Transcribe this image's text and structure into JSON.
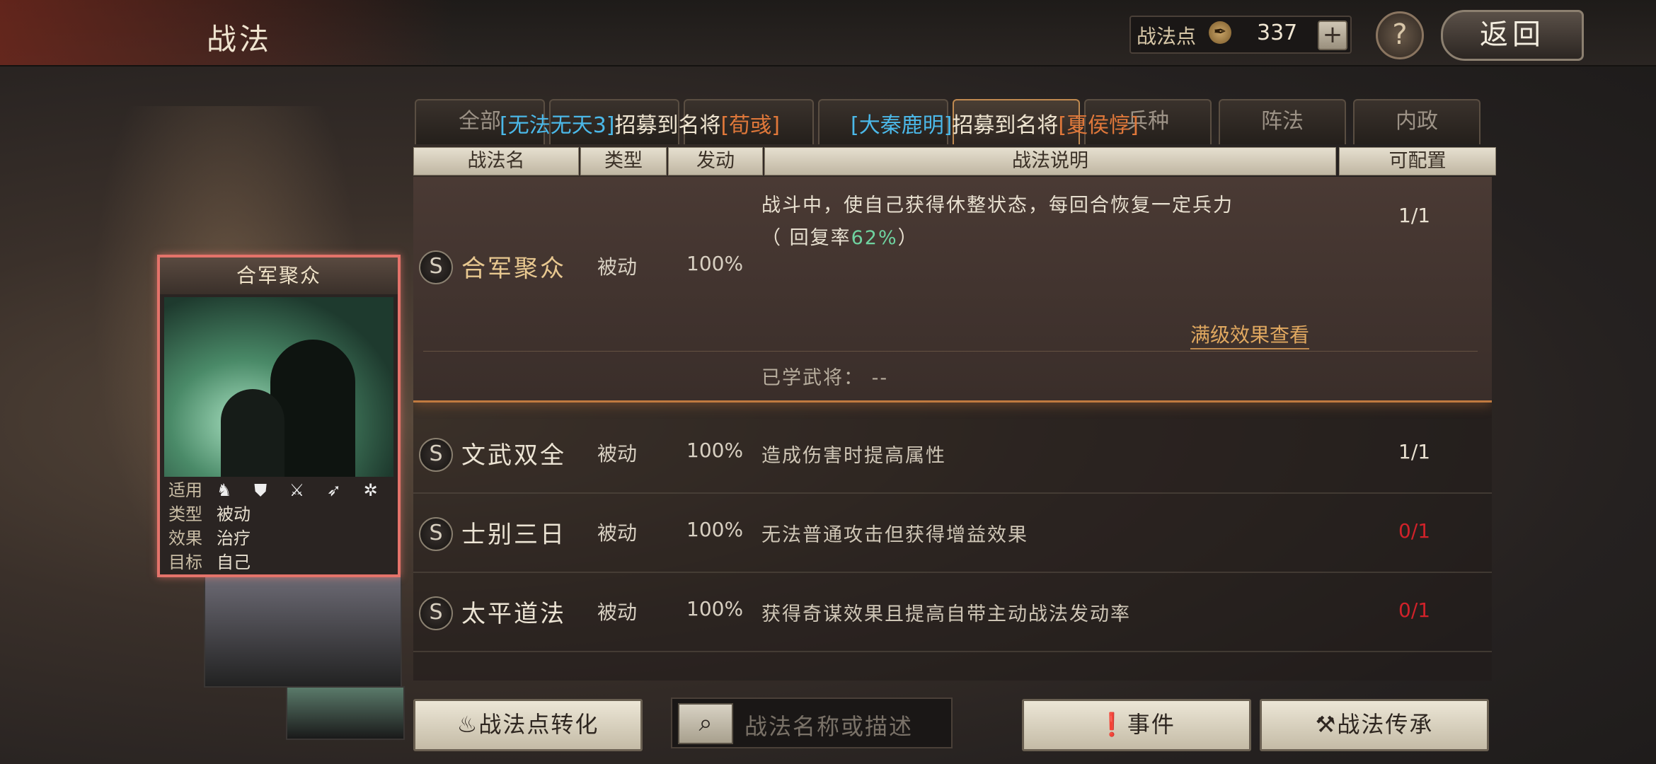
{
  "header": {
    "title": "战法",
    "points_label": "战法点",
    "points_icon": "feather-coin-icon",
    "points_value": "337",
    "plus": "+",
    "help": "?",
    "back": "返回"
  },
  "tabs": [
    {
      "label": "全部",
      "active": false
    },
    {
      "label": "",
      "active": false
    },
    {
      "label": "",
      "active": false
    },
    {
      "label": "",
      "active": false
    },
    {
      "label": "",
      "active": true
    },
    {
      "label": "兵种",
      "active": false
    },
    {
      "label": "阵法",
      "active": false
    },
    {
      "label": "内政",
      "active": false
    }
  ],
  "notices": [
    {
      "a": "[无法无天3]",
      "b": "招募到名将",
      "c": "[荀彧]"
    },
    {
      "a": "[大秦鹿明]",
      "b": "招募到名将",
      "c": "[夏侯惇]"
    }
  ],
  "columns": {
    "name": "战法名",
    "type": "类型",
    "trigger": "发动",
    "desc": "战法说明",
    "config": "可配置"
  },
  "selected": {
    "badge": "S",
    "name": "合军聚众",
    "type": "被动",
    "rate": "100%",
    "desc_line1": "战斗中，使自己获得休整状态，每回合恢复一定兵力",
    "desc_line2_pre": "（ 回复率",
    "desc_line2_val": "62%",
    "desc_line2_post": "）",
    "config": "1/1",
    "max_link": "满级效果查看",
    "learned_label": "已学武将：",
    "learned_value": "--"
  },
  "rows": [
    {
      "badge": "S",
      "name": "文武双全",
      "type": "被动",
      "rate": "100%",
      "desc": "造成伤害时提高属性",
      "config": "1/1",
      "available": true
    },
    {
      "badge": "S",
      "name": "士别三日",
      "type": "被动",
      "rate": "100%",
      "desc": "无法普通攻击但获得增益效果",
      "config": "0/1",
      "available": false
    },
    {
      "badge": "S",
      "name": "太平道法",
      "type": "被动",
      "rate": "100%",
      "desc": "获得奇谋效果且提高自带主动战法发动率",
      "config": "0/1",
      "available": false
    }
  ],
  "card": {
    "title": "合军聚众",
    "k_apply": "适用",
    "apply_icons": "♞ ⛊ ⚔ ➶ ✲",
    "k_type": "类型",
    "v_type": "被动",
    "k_effect": "效果",
    "v_effect": "治疗",
    "k_target": "目标",
    "v_target": "自己"
  },
  "bottom": {
    "convert": "战法点转化",
    "convert_icon": "flame-icon",
    "search_placeholder": "战法名称或描述",
    "events": "事件",
    "events_icon": "alert-icon",
    "inherit": "战法传承",
    "inherit_icon": "hammer-icon"
  },
  "colors": {
    "accent": "#c08a50",
    "highlight": "#6fd3a0",
    "unavailable": "#d0222a",
    "notice_blue": "#4bb8e8",
    "notice_orange": "#e0783a"
  }
}
